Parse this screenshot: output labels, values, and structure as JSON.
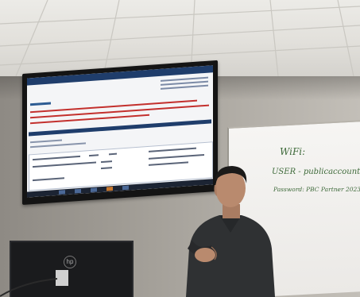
{
  "scene": {
    "description_type": "photo",
    "colors": {
      "ceiling": "#e5e3de",
      "wall": "#a29e97",
      "tv_bezel": "#141414",
      "screen_bg": "#f4f5f7",
      "screen_header": "#1f3d6b",
      "screen_red_text": "#c3302d",
      "whiteboard": "#f2f1ee",
      "marker": "#3e6a3a",
      "sweater": "#2f3133",
      "skin": "#b98a6e",
      "hair": "#1b1a19"
    }
  },
  "whiteboard": {
    "line1": "WiFi:",
    "line2": "USER - publicaccount",
    "line3": "Password: PBC Partner 2023"
  },
  "monitor": {
    "logo": "hp"
  }
}
